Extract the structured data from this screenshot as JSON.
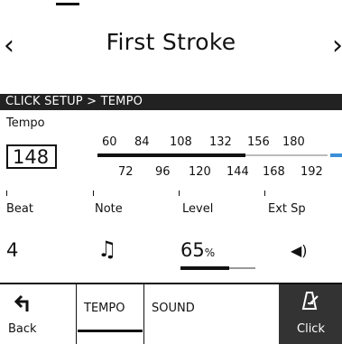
{
  "header": {
    "title": "First Stroke",
    "prev_icon": "chevron-left-icon",
    "next_icon": "chevron-right-icon",
    "prev_glyph": "‹",
    "next_glyph": "›"
  },
  "breadcrumb": "CLICK SETUP > TEMPO",
  "tempo": {
    "label": "Tempo",
    "value": "148",
    "scale_top": [
      "60",
      "84",
      "108",
      "132",
      "156",
      "180"
    ],
    "scale_bottom": [
      "72",
      "96",
      "120",
      "144",
      "168",
      "192"
    ],
    "accent_color": "#3a8fd8"
  },
  "params": [
    {
      "label": "Beat",
      "value": "4"
    },
    {
      "label": "Note",
      "value": "♫",
      "icon": "eighth-notes-icon"
    },
    {
      "label": "Level",
      "value": "65",
      "unit": "%",
      "level_fraction": 0.65
    },
    {
      "label": "Ext Sp",
      "value": "◀)",
      "icon": "speaker-icon"
    }
  ],
  "bottom_bar": {
    "back_label": "Back",
    "back_icon": "back-arrow-icon",
    "tabs": [
      "TEMPO",
      "SOUND"
    ],
    "click_label": "Click",
    "click_icon": "metronome-icon"
  }
}
